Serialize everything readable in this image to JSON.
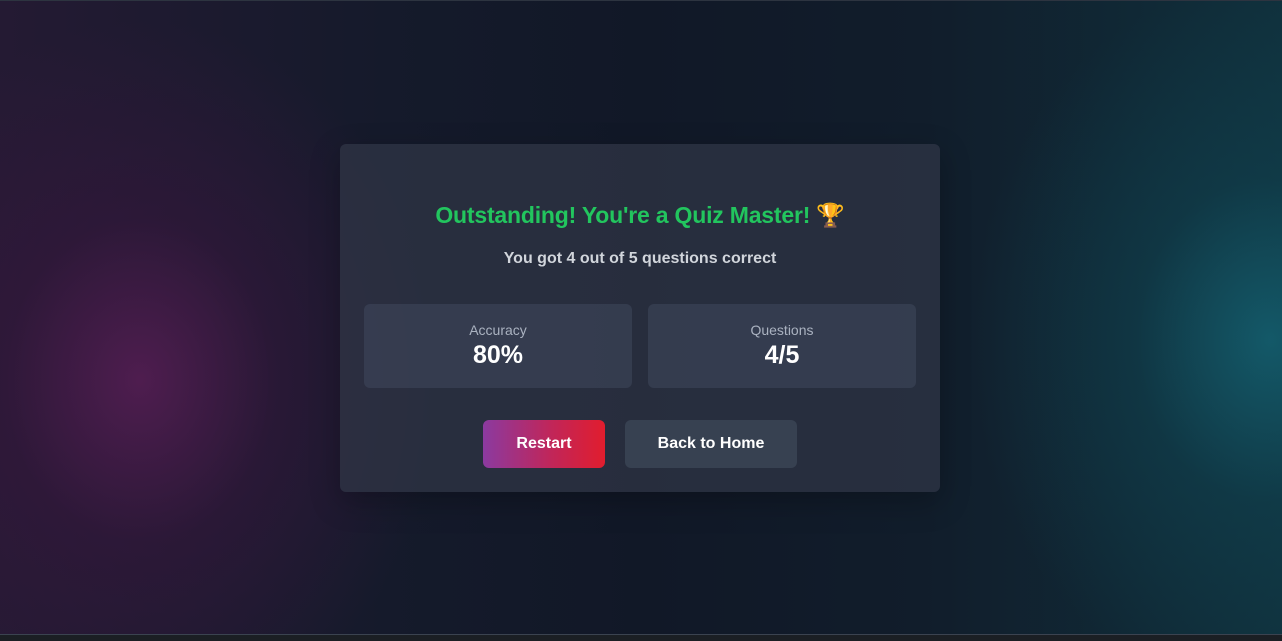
{
  "result": {
    "title": "Outstanding! You're a Quiz Master!",
    "title_icon": "trophy-icon",
    "title_emoji": "🏆",
    "subtitle": "You got 4 out of 5 questions correct"
  },
  "stats": {
    "accuracy": {
      "label": "Accuracy",
      "value": "80%"
    },
    "questions": {
      "label": "Questions",
      "value": "4/5"
    }
  },
  "actions": {
    "restart_label": "Restart",
    "home_label": "Back to Home"
  },
  "colors": {
    "title_green": "#22c55e",
    "restart_gradient_start": "#8b3aa0",
    "restart_gradient_end": "#e11d2e",
    "home_button": "#374151",
    "page_background": "#111827"
  }
}
